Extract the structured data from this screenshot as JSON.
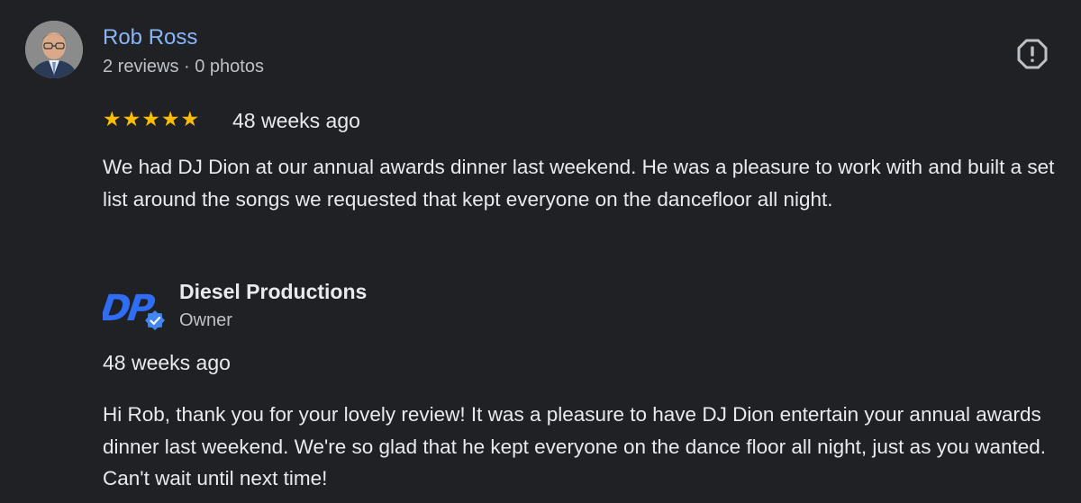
{
  "review": {
    "reviewer_name": "Rob Ross",
    "reviewer_meta": "2 reviews · 0 photos",
    "rating": 5,
    "time": "48 weeks ago",
    "text": "We had DJ Dion at our annual awards dinner last weekend. He was a pleasure to work with and built a set list around the songs we requested that kept everyone on the dancefloor all night."
  },
  "owner_reply": {
    "logo_text": "DP",
    "name": "Diesel Productions",
    "role": "Owner",
    "time": "48 weeks ago",
    "text": "Hi Rob, thank you for your lovely review! It was a pleasure to have DJ Dion entertain your annual awards dinner last weekend. We're so glad that he kept everyone on the dance floor all night, just as you wanted. Can't wait until next time!"
  },
  "icons": {
    "report": "report-flag-icon",
    "verified": "verified-badge-icon",
    "star": "star-icon"
  },
  "colors": {
    "background": "#202124",
    "reviewer_name": "#8ab4f8",
    "star": "#fbbc04",
    "logo_blue": "#2f6df6"
  }
}
